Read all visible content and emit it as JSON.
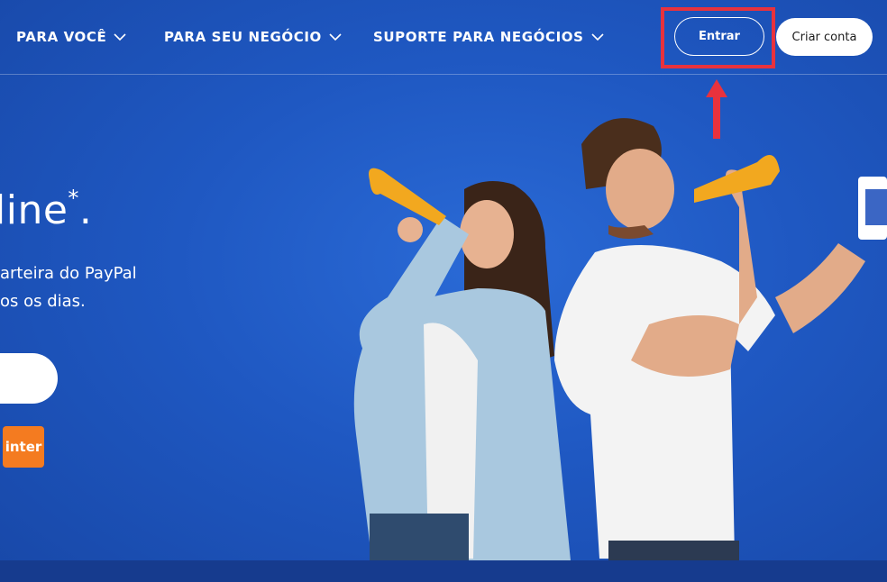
{
  "nav": {
    "items": [
      {
        "label": "PARA VOCÊ"
      },
      {
        "label": "PARA SEU NEGÓCIO"
      },
      {
        "label": "SUPORTE PARA NEGÓCIOS"
      }
    ],
    "login_label": "Entrar",
    "signup_label": "Criar conta"
  },
  "hero": {
    "headline": "line",
    "headline_mark": "*",
    "headline_end": ".",
    "description_lines": [
      "arteira do PayPal",
      "os os dias."
    ],
    "partner_logo": "inter"
  },
  "colors": {
    "background": "#1f56b8",
    "highlight_box": "#e8323d",
    "inter_logo": "#f47b20"
  },
  "icons": [
    "chevron-down-icon",
    "red-arrow-up-icon"
  ]
}
